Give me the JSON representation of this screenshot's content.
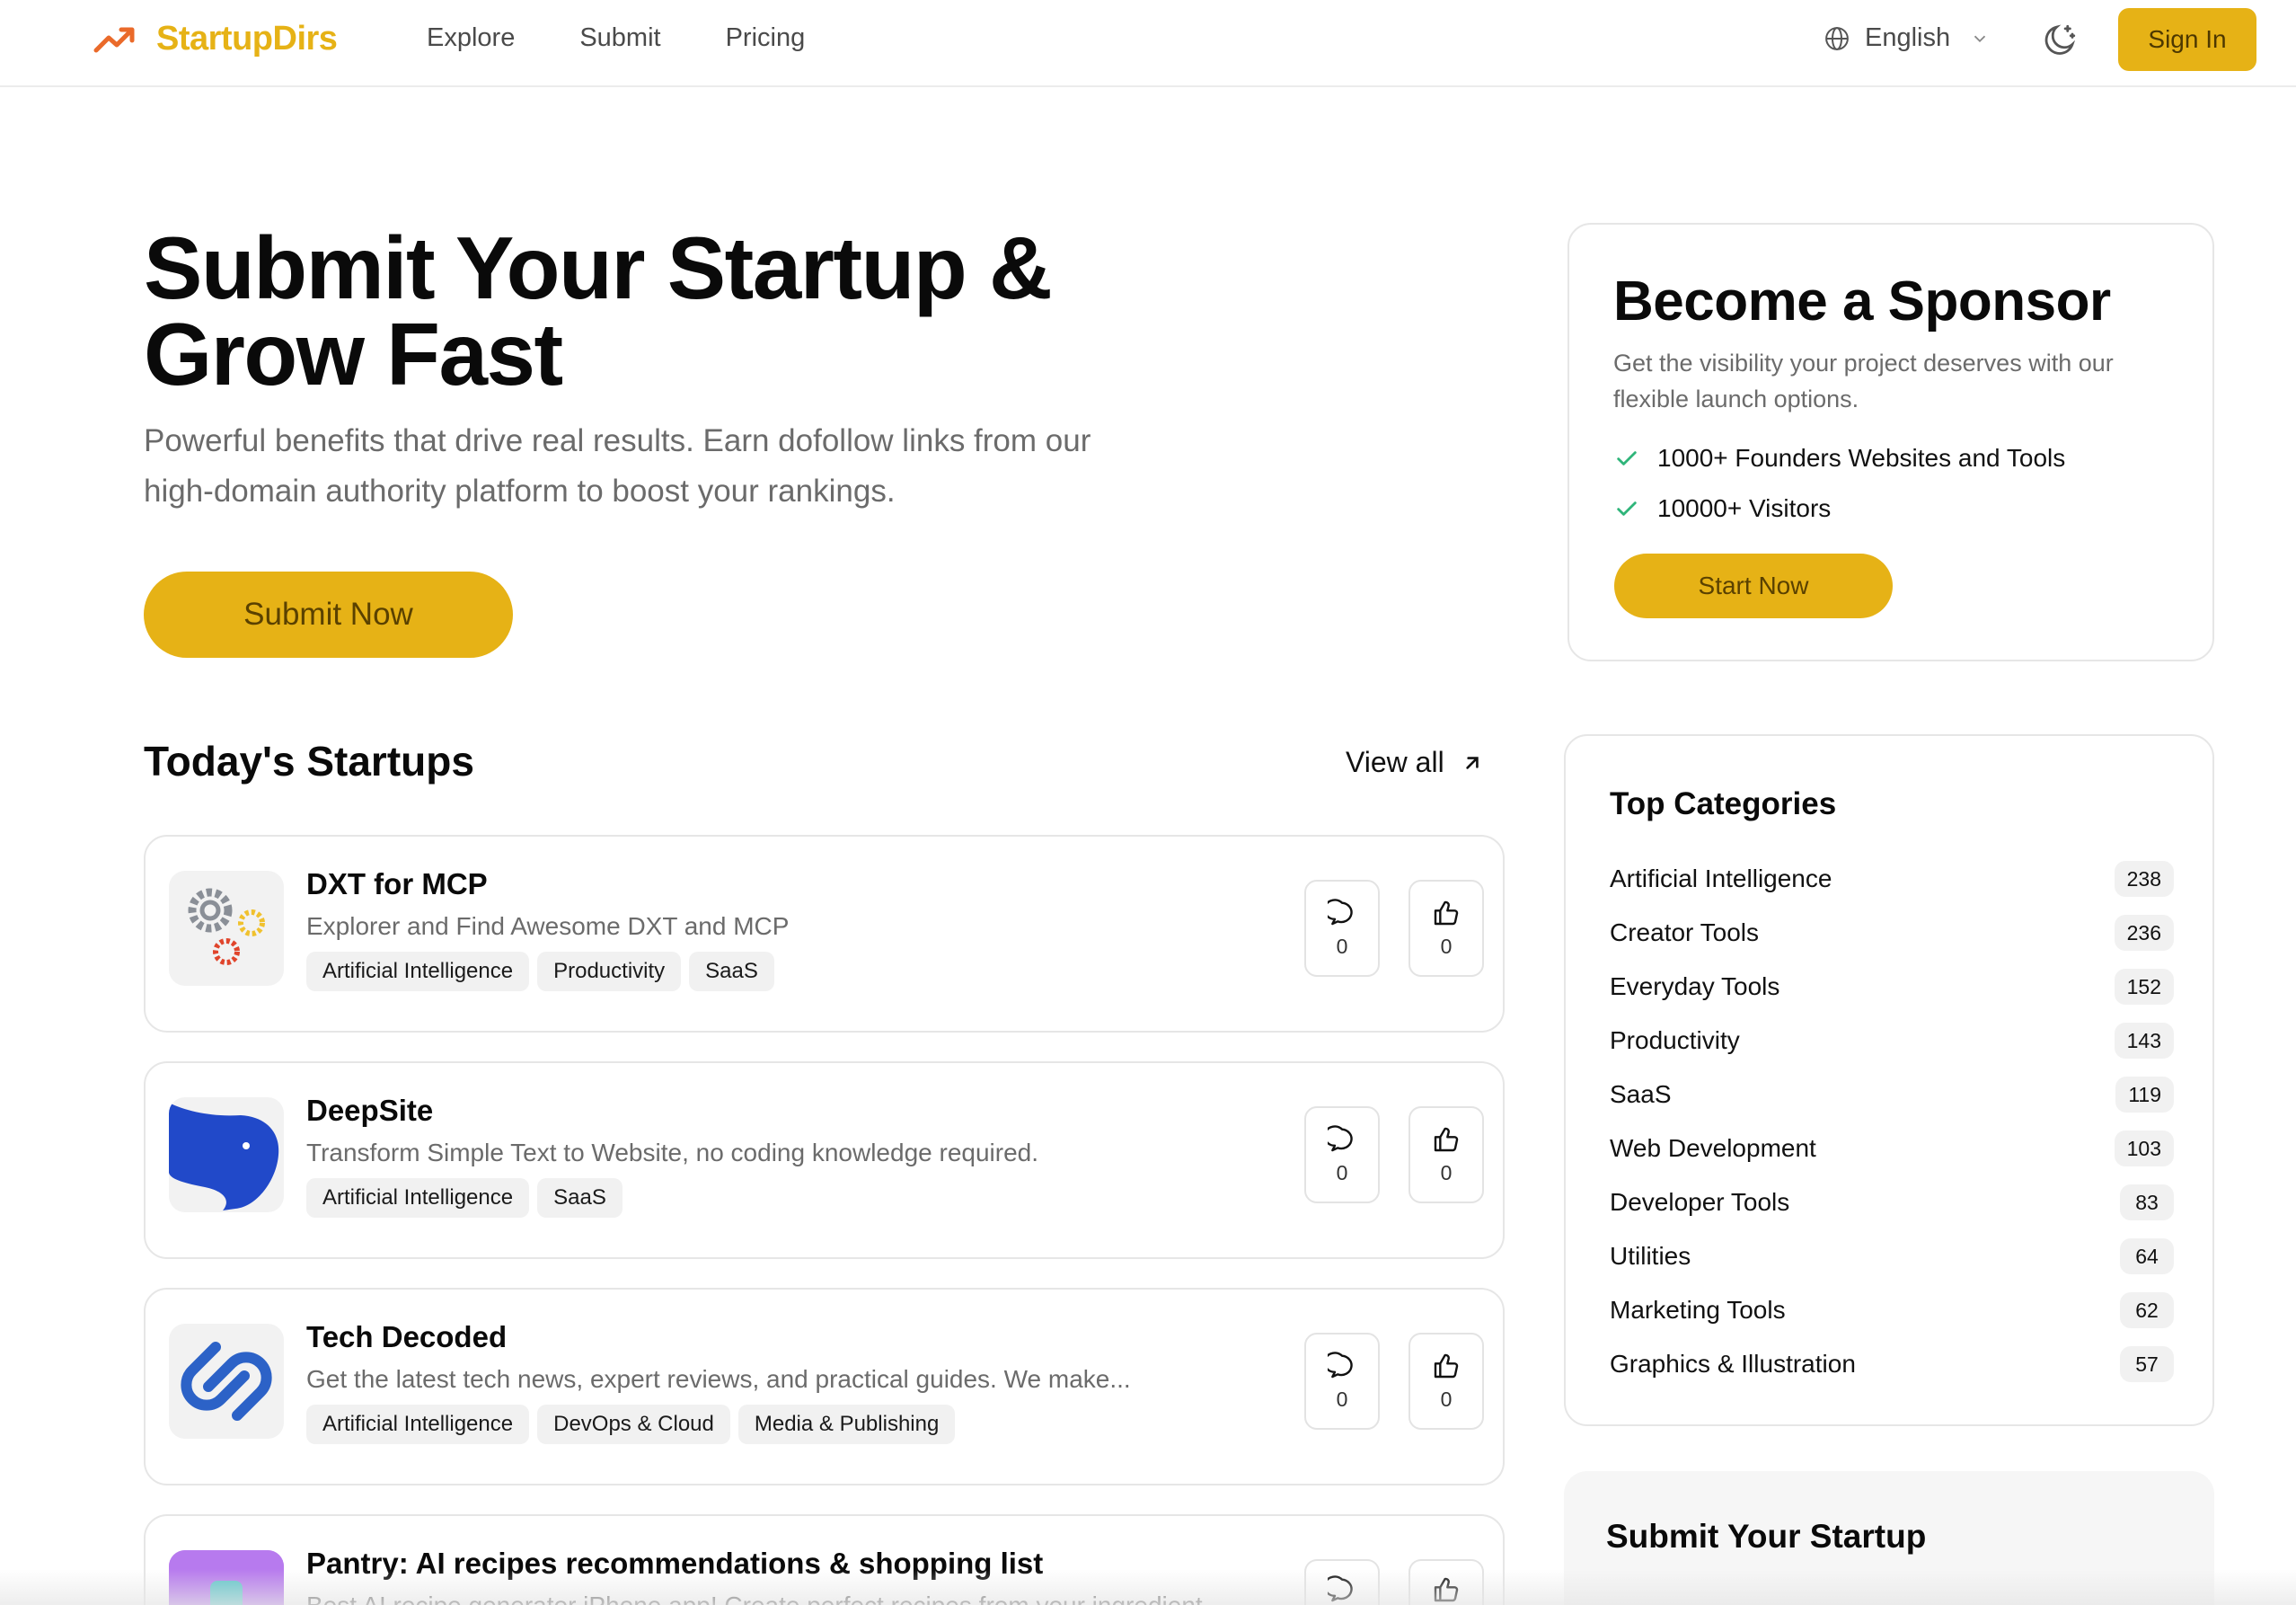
{
  "header": {
    "brand": "StartupDirs",
    "nav": [
      "Explore",
      "Submit",
      "Pricing"
    ],
    "language": "English",
    "sign_in": "Sign In"
  },
  "hero": {
    "title": "Submit Your Startup & Grow Fast",
    "subtitle": "Powerful benefits that drive real results. Earn dofollow links from our high-domain authority platform to boost your rankings.",
    "cta": "Submit Now"
  },
  "sponsor": {
    "title": "Become a Sponsor",
    "text": "Get the visibility your project deserves with our flexible launch options.",
    "points": [
      "1000+ Founders Websites and Tools",
      "10000+ Visitors"
    ],
    "cta": "Start Now"
  },
  "today": {
    "title": "Today's Startups",
    "view_all": "View all",
    "items": [
      {
        "name": "DXT for MCP",
        "desc": "Explorer and Find Awesome DXT and MCP",
        "tags": [
          "Artificial Intelligence",
          "Productivity",
          "SaaS"
        ],
        "comments": "0",
        "upvotes": "0"
      },
      {
        "name": "DeepSite",
        "desc": "Transform Simple Text to Website, no coding knowledge required.",
        "tags": [
          "Artificial Intelligence",
          "SaaS"
        ],
        "comments": "0",
        "upvotes": "0"
      },
      {
        "name": "Tech Decoded",
        "desc": "Get the latest tech news, expert reviews, and practical guides. We make...",
        "tags": [
          "Artificial Intelligence",
          "DevOps & Cloud",
          "Media & Publishing"
        ],
        "comments": "0",
        "upvotes": "0"
      },
      {
        "name": "Pantry: AI recipes recommendations & shopping list",
        "desc": "Best AI recipe generator iPhone app! Create perfect recipes from your ingredient...",
        "tags": [],
        "comments": "",
        "upvotes": ""
      }
    ]
  },
  "categories": {
    "title": "Top Categories",
    "items": [
      {
        "name": "Artificial Intelligence",
        "count": "238"
      },
      {
        "name": "Creator Tools",
        "count": "236"
      },
      {
        "name": "Everyday Tools",
        "count": "152"
      },
      {
        "name": "Productivity",
        "count": "143"
      },
      {
        "name": "SaaS",
        "count": "119"
      },
      {
        "name": "Web Development",
        "count": "103"
      },
      {
        "name": "Developer Tools",
        "count": "83"
      },
      {
        "name": "Utilities",
        "count": "64"
      },
      {
        "name": "Marketing Tools",
        "count": "62"
      },
      {
        "name": "Graphics & Illustration",
        "count": "57"
      }
    ]
  },
  "submit_box": {
    "title": "Submit Your Startup"
  },
  "colors": {
    "accent": "#e6b216",
    "check": "#2fb57a"
  }
}
